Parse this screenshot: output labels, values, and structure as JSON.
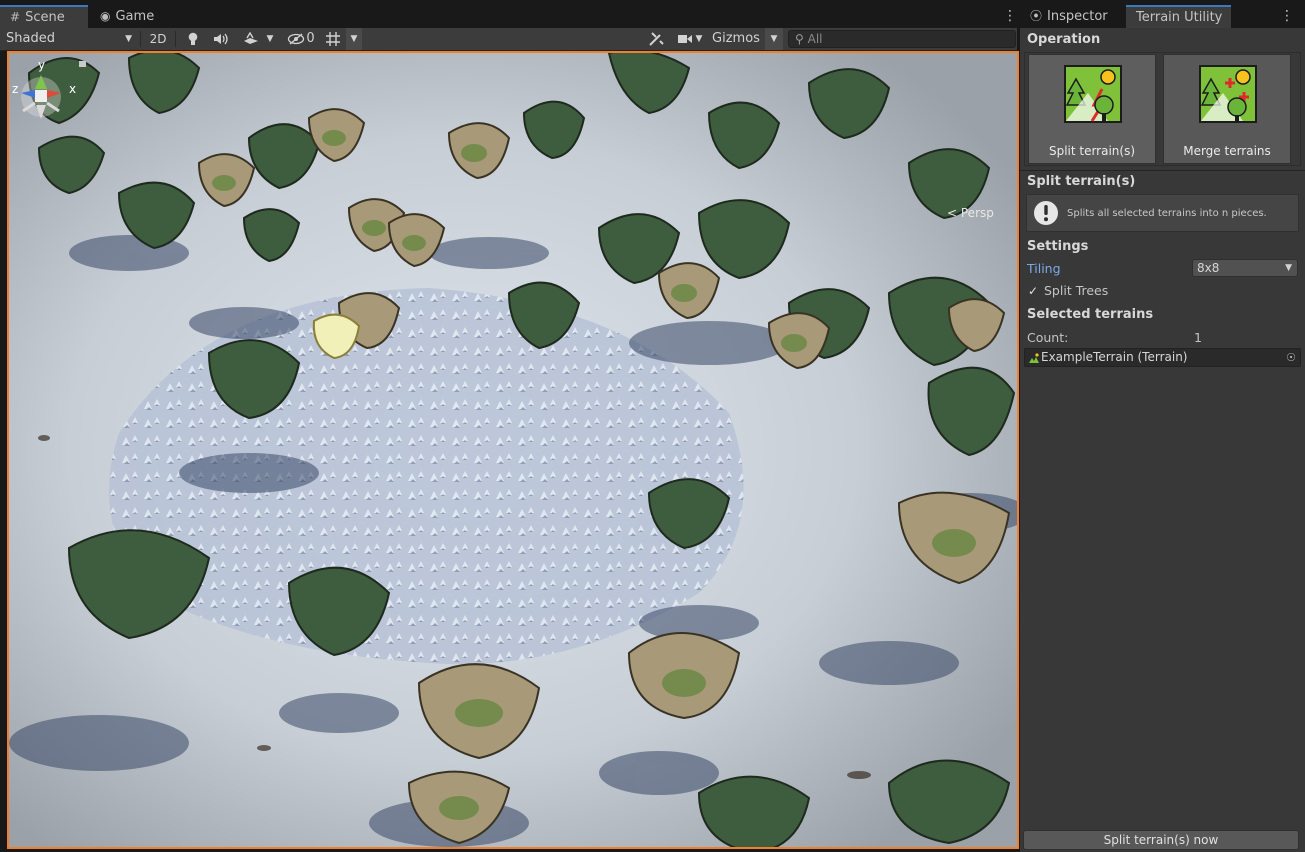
{
  "scene_tabs": [
    {
      "icon": "grid-icon",
      "label": "Scene",
      "active": true
    },
    {
      "icon": "gamepad-icon",
      "label": "Game",
      "active": false
    }
  ],
  "scene_toolbar": {
    "draw_mode": "Shaded",
    "mode_2d": "2D",
    "hidden_count": "0",
    "gizmos": "Gizmos",
    "search_placeholder": "All"
  },
  "viewport": {
    "camera_label": "Persp",
    "axes": {
      "y": "y",
      "z": "z",
      "x": "x"
    }
  },
  "inspector_tabs": [
    {
      "icon": "info-icon",
      "label": "Inspector",
      "active": false
    },
    {
      "label": "Terrain Utility",
      "active": true
    }
  ],
  "terrain_utility": {
    "operation_title": "Operation",
    "buttons": [
      {
        "label": "Split terrain(s)",
        "selected": true
      },
      {
        "label": "Merge terrains",
        "selected": false
      }
    ],
    "split_title": "Split terrain(s)",
    "help_text": "Splits all selected terrains into n pieces.",
    "settings_title": "Settings",
    "tiling_label": "Tiling",
    "tiling_value": "8x8",
    "split_trees_label": "Split Trees",
    "split_trees_checked": true,
    "selected_title": "Selected terrains",
    "count_label": "Count:",
    "count_value": "1",
    "terrain_field": "ExampleTerrain (Terrain)",
    "action_button": "Split terrain(s) now"
  },
  "colors": {
    "accent_blue": "#3a79bb",
    "viewport_border": "#f0802c",
    "tiling_label": "#7ba9e8"
  }
}
